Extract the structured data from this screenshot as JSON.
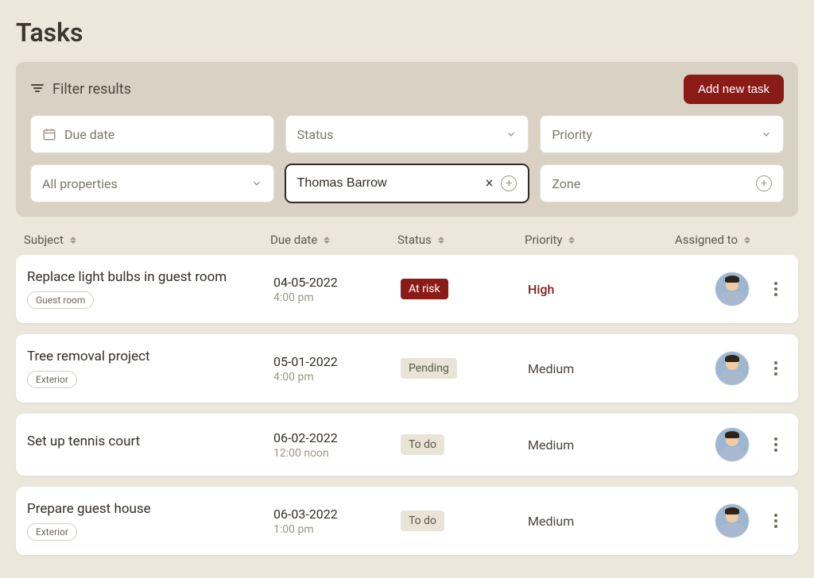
{
  "page": {
    "title": "Tasks"
  },
  "filter": {
    "label": "Filter results",
    "add_button": "Add new task",
    "fields": {
      "due_date": "Due date",
      "status": "Status",
      "priority": "Priority",
      "all_properties": "All properties",
      "assignee_value": "Thomas Barrow",
      "zone": "Zone"
    }
  },
  "columns": {
    "subject": "Subject",
    "due_date": "Due date",
    "status": "Status",
    "priority": "Priority",
    "assigned_to": "Assigned to"
  },
  "status_labels": {
    "at_risk": "At risk",
    "pending": "Pending",
    "to_do": "To do"
  },
  "priority_labels": {
    "high": "High",
    "medium": "Medium"
  },
  "tasks": [
    {
      "subject": "Replace light bulbs in guest room",
      "tag": "Guest room",
      "date": "04-05-2022",
      "time": "4:00 pm",
      "status_key": "at_risk",
      "priority_key": "high"
    },
    {
      "subject": "Tree removal project",
      "tag": "Exterior",
      "date": "05-01-2022",
      "time": "4:00 pm",
      "status_key": "pending",
      "priority_key": "medium"
    },
    {
      "subject": "Set up tennis court",
      "tag": "",
      "date": "06-02-2022",
      "time": "12:00 noon",
      "status_key": "to_do",
      "priority_key": "medium"
    },
    {
      "subject": "Prepare guest house",
      "tag": "Exterior",
      "date": "06-03-2022",
      "time": "1:00 pm",
      "status_key": "to_do",
      "priority_key": "medium"
    }
  ]
}
